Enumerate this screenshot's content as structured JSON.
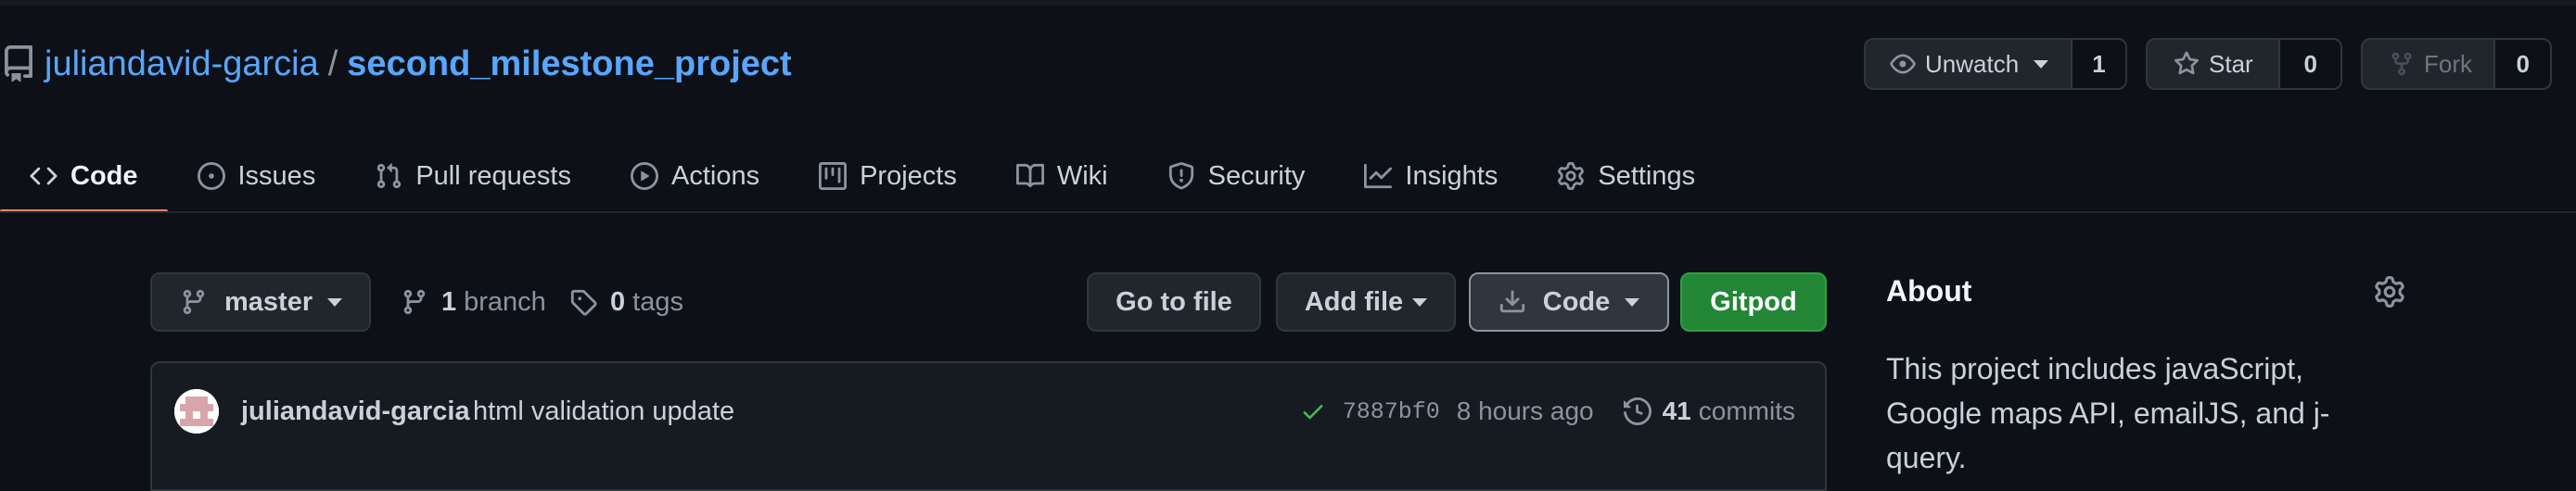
{
  "repo": {
    "owner": "juliandavid-garcia",
    "separator": "/",
    "name": "second_milestone_project"
  },
  "header_actions": {
    "watch": {
      "label": "Unwatch",
      "count": "1"
    },
    "star": {
      "label": "Star",
      "count": "0"
    },
    "fork": {
      "label": "Fork",
      "count": "0"
    }
  },
  "nav": {
    "tabs": [
      {
        "label": "Code",
        "icon": "code-icon",
        "selected": true
      },
      {
        "label": "Issues",
        "icon": "issue-icon"
      },
      {
        "label": "Pull requests",
        "icon": "pull-request-icon"
      },
      {
        "label": "Actions",
        "icon": "play-icon"
      },
      {
        "label": "Projects",
        "icon": "project-icon"
      },
      {
        "label": "Wiki",
        "icon": "book-icon"
      },
      {
        "label": "Security",
        "icon": "shield-icon"
      },
      {
        "label": "Insights",
        "icon": "graph-icon"
      },
      {
        "label": "Settings",
        "icon": "gear-icon"
      }
    ]
  },
  "file_nav": {
    "branch": "master",
    "branches_count": "1",
    "branches_label": "branch",
    "tags_count": "0",
    "tags_label": "tags",
    "goto_file": "Go to file",
    "add_file": "Add file",
    "code": "Code",
    "gitpod": "Gitpod"
  },
  "commit": {
    "author": "juliandavid-garcia",
    "message": "html validation update",
    "sha": "7887bf0",
    "time_ago": "8 hours ago",
    "commits_count": "41",
    "commits_label": "commits"
  },
  "about": {
    "title": "About",
    "description": "This project includes javaScript, Google maps API, emailJS, and j-query."
  },
  "colors": {
    "background": "#0d1117",
    "link": "#58a6ff",
    "tab_underline": "#f78166",
    "gitpod_button": "#238636",
    "check": "#3fb950"
  }
}
